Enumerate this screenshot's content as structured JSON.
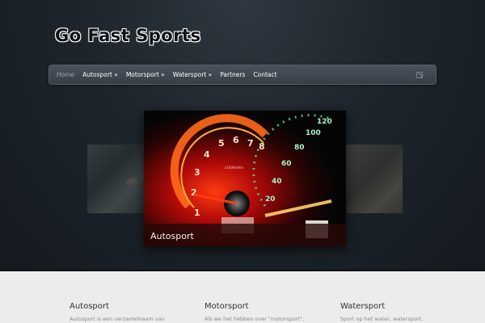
{
  "site": {
    "logo": "Go Fast Sports"
  },
  "nav": {
    "items": [
      {
        "label": "Home",
        "active": true
      },
      {
        "label": "Autosport »"
      },
      {
        "label": "Motorsport »"
      },
      {
        "label": "Watersport »"
      },
      {
        "label": "Partners"
      },
      {
        "label": "Contact"
      }
    ],
    "rss_icon": "rss-icon"
  },
  "slider": {
    "caption": "Autosport",
    "speedo_numbers": [
      "1",
      "2",
      "3",
      "4",
      "5",
      "6",
      "7",
      "8"
    ],
    "speedo_outer": [
      "20",
      "40",
      "60",
      "80",
      "100",
      "120"
    ],
    "trip_label": "x1000r/min"
  },
  "columns": [
    {
      "title": "Autosport",
      "text": "Autosport is een verzamelnaam van"
    },
    {
      "title": "Motorsport",
      "text": "Als we het hebben over \"motorsport\","
    },
    {
      "title": "Watersport",
      "text": "Sport op het water, watersport."
    }
  ],
  "colors": {
    "accent": "#c6141a",
    "nav": "#3c444e",
    "bg": "#1e252d"
  }
}
